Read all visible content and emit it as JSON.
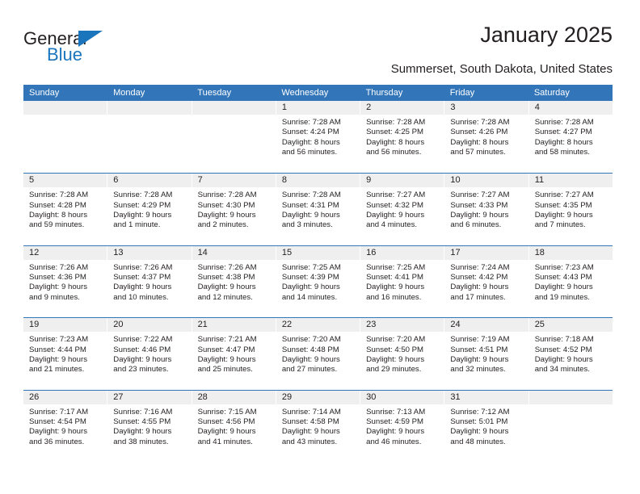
{
  "brand": {
    "name_part1": "General",
    "name_part2": "Blue"
  },
  "header": {
    "title": "January 2025",
    "subtitle": "Summerset, South Dakota, United States"
  },
  "weekdays": [
    "Sunday",
    "Monday",
    "Tuesday",
    "Wednesday",
    "Thursday",
    "Friday",
    "Saturday"
  ],
  "colors": {
    "header_blue": "#3275b9",
    "logo_blue": "#1b75bc",
    "daynum_band": "#efefef",
    "text": "#231f20"
  },
  "weeks": [
    [
      {
        "day": "",
        "lines": []
      },
      {
        "day": "",
        "lines": []
      },
      {
        "day": "",
        "lines": []
      },
      {
        "day": "1",
        "lines": [
          "Sunrise: 7:28 AM",
          "Sunset: 4:24 PM",
          "Daylight: 8 hours",
          "and 56 minutes."
        ]
      },
      {
        "day": "2",
        "lines": [
          "Sunrise: 7:28 AM",
          "Sunset: 4:25 PM",
          "Daylight: 8 hours",
          "and 56 minutes."
        ]
      },
      {
        "day": "3",
        "lines": [
          "Sunrise: 7:28 AM",
          "Sunset: 4:26 PM",
          "Daylight: 8 hours",
          "and 57 minutes."
        ]
      },
      {
        "day": "4",
        "lines": [
          "Sunrise: 7:28 AM",
          "Sunset: 4:27 PM",
          "Daylight: 8 hours",
          "and 58 minutes."
        ]
      }
    ],
    [
      {
        "day": "5",
        "lines": [
          "Sunrise: 7:28 AM",
          "Sunset: 4:28 PM",
          "Daylight: 8 hours",
          "and 59 minutes."
        ]
      },
      {
        "day": "6",
        "lines": [
          "Sunrise: 7:28 AM",
          "Sunset: 4:29 PM",
          "Daylight: 9 hours",
          "and 1 minute."
        ]
      },
      {
        "day": "7",
        "lines": [
          "Sunrise: 7:28 AM",
          "Sunset: 4:30 PM",
          "Daylight: 9 hours",
          "and 2 minutes."
        ]
      },
      {
        "day": "8",
        "lines": [
          "Sunrise: 7:28 AM",
          "Sunset: 4:31 PM",
          "Daylight: 9 hours",
          "and 3 minutes."
        ]
      },
      {
        "day": "9",
        "lines": [
          "Sunrise: 7:27 AM",
          "Sunset: 4:32 PM",
          "Daylight: 9 hours",
          "and 4 minutes."
        ]
      },
      {
        "day": "10",
        "lines": [
          "Sunrise: 7:27 AM",
          "Sunset: 4:33 PM",
          "Daylight: 9 hours",
          "and 6 minutes."
        ]
      },
      {
        "day": "11",
        "lines": [
          "Sunrise: 7:27 AM",
          "Sunset: 4:35 PM",
          "Daylight: 9 hours",
          "and 7 minutes."
        ]
      }
    ],
    [
      {
        "day": "12",
        "lines": [
          "Sunrise: 7:26 AM",
          "Sunset: 4:36 PM",
          "Daylight: 9 hours",
          "and 9 minutes."
        ]
      },
      {
        "day": "13",
        "lines": [
          "Sunrise: 7:26 AM",
          "Sunset: 4:37 PM",
          "Daylight: 9 hours",
          "and 10 minutes."
        ]
      },
      {
        "day": "14",
        "lines": [
          "Sunrise: 7:26 AM",
          "Sunset: 4:38 PM",
          "Daylight: 9 hours",
          "and 12 minutes."
        ]
      },
      {
        "day": "15",
        "lines": [
          "Sunrise: 7:25 AM",
          "Sunset: 4:39 PM",
          "Daylight: 9 hours",
          "and 14 minutes."
        ]
      },
      {
        "day": "16",
        "lines": [
          "Sunrise: 7:25 AM",
          "Sunset: 4:41 PM",
          "Daylight: 9 hours",
          "and 16 minutes."
        ]
      },
      {
        "day": "17",
        "lines": [
          "Sunrise: 7:24 AM",
          "Sunset: 4:42 PM",
          "Daylight: 9 hours",
          "and 17 minutes."
        ]
      },
      {
        "day": "18",
        "lines": [
          "Sunrise: 7:23 AM",
          "Sunset: 4:43 PM",
          "Daylight: 9 hours",
          "and 19 minutes."
        ]
      }
    ],
    [
      {
        "day": "19",
        "lines": [
          "Sunrise: 7:23 AM",
          "Sunset: 4:44 PM",
          "Daylight: 9 hours",
          "and 21 minutes."
        ]
      },
      {
        "day": "20",
        "lines": [
          "Sunrise: 7:22 AM",
          "Sunset: 4:46 PM",
          "Daylight: 9 hours",
          "and 23 minutes."
        ]
      },
      {
        "day": "21",
        "lines": [
          "Sunrise: 7:21 AM",
          "Sunset: 4:47 PM",
          "Daylight: 9 hours",
          "and 25 minutes."
        ]
      },
      {
        "day": "22",
        "lines": [
          "Sunrise: 7:20 AM",
          "Sunset: 4:48 PM",
          "Daylight: 9 hours",
          "and 27 minutes."
        ]
      },
      {
        "day": "23",
        "lines": [
          "Sunrise: 7:20 AM",
          "Sunset: 4:50 PM",
          "Daylight: 9 hours",
          "and 29 minutes."
        ]
      },
      {
        "day": "24",
        "lines": [
          "Sunrise: 7:19 AM",
          "Sunset: 4:51 PM",
          "Daylight: 9 hours",
          "and 32 minutes."
        ]
      },
      {
        "day": "25",
        "lines": [
          "Sunrise: 7:18 AM",
          "Sunset: 4:52 PM",
          "Daylight: 9 hours",
          "and 34 minutes."
        ]
      }
    ],
    [
      {
        "day": "26",
        "lines": [
          "Sunrise: 7:17 AM",
          "Sunset: 4:54 PM",
          "Daylight: 9 hours",
          "and 36 minutes."
        ]
      },
      {
        "day": "27",
        "lines": [
          "Sunrise: 7:16 AM",
          "Sunset: 4:55 PM",
          "Daylight: 9 hours",
          "and 38 minutes."
        ]
      },
      {
        "day": "28",
        "lines": [
          "Sunrise: 7:15 AM",
          "Sunset: 4:56 PM",
          "Daylight: 9 hours",
          "and 41 minutes."
        ]
      },
      {
        "day": "29",
        "lines": [
          "Sunrise: 7:14 AM",
          "Sunset: 4:58 PM",
          "Daylight: 9 hours",
          "and 43 minutes."
        ]
      },
      {
        "day": "30",
        "lines": [
          "Sunrise: 7:13 AM",
          "Sunset: 4:59 PM",
          "Daylight: 9 hours",
          "and 46 minutes."
        ]
      },
      {
        "day": "31",
        "lines": [
          "Sunrise: 7:12 AM",
          "Sunset: 5:01 PM",
          "Daylight: 9 hours",
          "and 48 minutes."
        ]
      },
      {
        "day": "",
        "lines": []
      }
    ]
  ]
}
